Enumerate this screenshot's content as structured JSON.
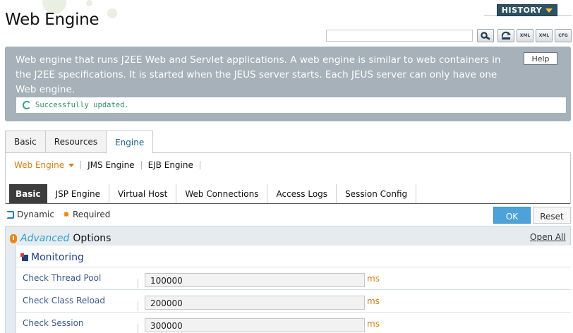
{
  "header": {
    "title": "Web Engine",
    "history_label": "HISTORY",
    "search_value": "",
    "tools": [
      {
        "name": "search-icon",
        "label": ""
      },
      {
        "name": "refresh-icon",
        "label": ""
      },
      {
        "name": "xml-export-icon",
        "label": "XML"
      },
      {
        "name": "xml-import-icon",
        "label": "XML"
      },
      {
        "name": "config-icon",
        "label": "CFG"
      }
    ]
  },
  "description": {
    "text": "Web engine that runs J2EE Web and Servlet applications. A web engine is similar to web containers in the J2EE specifications. It is started when the JEUS server starts. Each JEUS server can only have one Web engine.",
    "help_label": "Help",
    "status_message": "Successfully updated."
  },
  "tabs": [
    {
      "label": "Basic",
      "active": false
    },
    {
      "label": "Resources",
      "active": false
    },
    {
      "label": "Engine",
      "active": true
    }
  ],
  "engine_nav": [
    {
      "label": "Web Engine",
      "active": true
    },
    {
      "label": "JMS Engine",
      "active": false
    },
    {
      "label": "EJB Engine",
      "active": false
    }
  ],
  "sub_tabs": [
    {
      "label": "Basic",
      "active": true
    },
    {
      "label": "JSP Engine",
      "active": false
    },
    {
      "label": "Virtual Host",
      "active": false
    },
    {
      "label": "Web Connections",
      "active": false
    },
    {
      "label": "Access Logs",
      "active": false
    },
    {
      "label": "Session Config",
      "active": false
    }
  ],
  "legend": {
    "dynamic_label": "Dynamic",
    "required_label": "Required"
  },
  "actions": {
    "ok_label": "OK",
    "reset_label": "Reset"
  },
  "advanced": {
    "title_highlight": "Advanced",
    "title_rest": "Options",
    "open_all_label": "Open All",
    "section_title": "Monitoring",
    "fields": [
      {
        "label": "Check Thread Pool",
        "value": "100000",
        "unit": "ms"
      },
      {
        "label": "Check Class Reload",
        "value": "200000",
        "unit": "ms"
      },
      {
        "label": "Check Session",
        "value": "300000",
        "unit": "ms"
      }
    ]
  },
  "colors": {
    "accent_orange": "#d67d12",
    "ok_blue": "#4da3d9",
    "description_bg": "#a6b1b9",
    "success_green": "#2f8e6e",
    "history_bg": "#2d5262"
  }
}
